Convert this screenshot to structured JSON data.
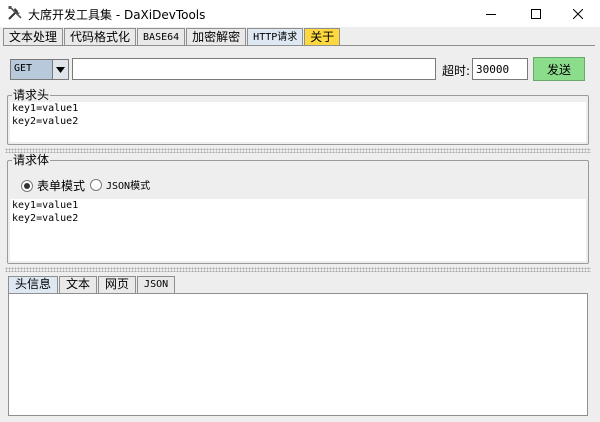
{
  "window": {
    "title": "大席开发工具集 - DaXiDevTools",
    "controls": {
      "minimize": "minimize-icon",
      "maximize": "maximize-icon",
      "close": "close-icon"
    }
  },
  "tabs": [
    {
      "label": "文本处理"
    },
    {
      "label": "代码格式化"
    },
    {
      "label": "BASE64"
    },
    {
      "label": "加密解密"
    },
    {
      "label": "HTTP请求"
    },
    {
      "label": "关于"
    }
  ],
  "request": {
    "method": "GET",
    "url": "",
    "timeout_label": "超时:",
    "timeout_value": "30000",
    "send_label": "发送"
  },
  "headers_panel": {
    "title": "请求头",
    "lines": [
      "key1=value1",
      "key2=value2"
    ]
  },
  "body_panel": {
    "title": "请求体",
    "radio_form": "表单模式",
    "radio_json": "JSON模式",
    "selected_mode": "表单模式",
    "lines": [
      "key1=value1",
      "key2=value2"
    ]
  },
  "response_tabs": [
    {
      "label": "头信息"
    },
    {
      "label": "文本"
    },
    {
      "label": "网页"
    },
    {
      "label": "JSON"
    }
  ],
  "colors": {
    "send_button": "#8bdc8b",
    "about_tab": "#ffd83f",
    "selected_tab": "#dde8f3",
    "frame_bg": "#eeeeee"
  }
}
